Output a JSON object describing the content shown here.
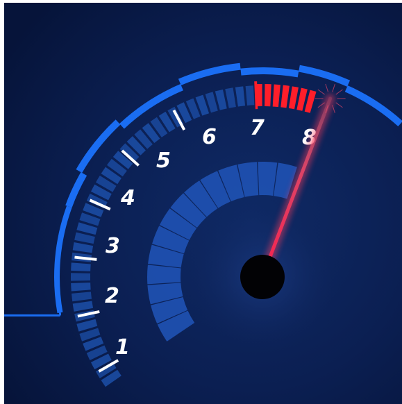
{
  "gauge": {
    "type": "tachometer",
    "tick_labels": [
      "1",
      "2",
      "3",
      "4",
      "5",
      "6",
      "7",
      "8"
    ],
    "redline_start": "7",
    "needle_value": 8.2,
    "colors": {
      "background": "#0b1f52",
      "outer_rim": "#1a6df2",
      "segments": "#1c4fa8",
      "inner_arc": "#1f52b4",
      "redline": "#ff1e2a",
      "needle": "#ff3a5a",
      "hub": "#020205",
      "labels": "#ffffff"
    }
  }
}
